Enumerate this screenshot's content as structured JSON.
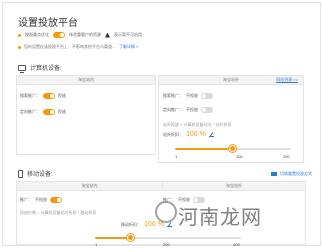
{
  "page": {
    "title": "设置投放平台",
    "legend": {
      "item1": "按照重点优化",
      "item2": "体验重客户的资源",
      "item3": "表示暂不可启用"
    },
    "note": {
      "text": "您的设置在该投放平台上…不影响其他平台与渠道…",
      "link": "了解详情 »"
    }
  },
  "computer": {
    "heading": "计算机设备:",
    "left": {
      "header": "淘宝站内",
      "row1_label": "搜索推广：",
      "row1_state": "投放",
      "row2_label": "定向推广：",
      "row2_state": "投放"
    },
    "right": {
      "header": "淘宝站外",
      "link": "网站列表 >>",
      "row1_label": "搜索推广：",
      "row1_state": "不投放",
      "row2_label": "定向推广：",
      "row2_state": "不投放",
      "hint": "站外投放 = 计算机设备站内 * 站外折扣",
      "pct_label": "站外折扣：",
      "pct_value": "100 %",
      "slider": {
        "min": "1",
        "mid": "100",
        "max": "200",
        "value": 100,
        "range": [
          1,
          200
        ]
      }
    }
  },
  "mobile": {
    "heading": "移动设备:",
    "link": "切换重置投放方式",
    "left": {
      "header": "淘宝站内",
      "row1_label": "推广：",
      "row1_state": "不投放"
    },
    "right": {
      "header": "淘宝站外",
      "row1_label": "推广：",
      "row1_state": "不投放"
    },
    "hint": "投放价格 = 计算机设备站内折扣 * 移动折扣",
    "pct_label": "移动折扣：",
    "pct_value": "100 %",
    "slider": {
      "min": "1",
      "mid": "200",
      "max": "400",
      "value": 100,
      "range": [
        1,
        400
      ]
    }
  },
  "watermark": "河南龙网"
}
